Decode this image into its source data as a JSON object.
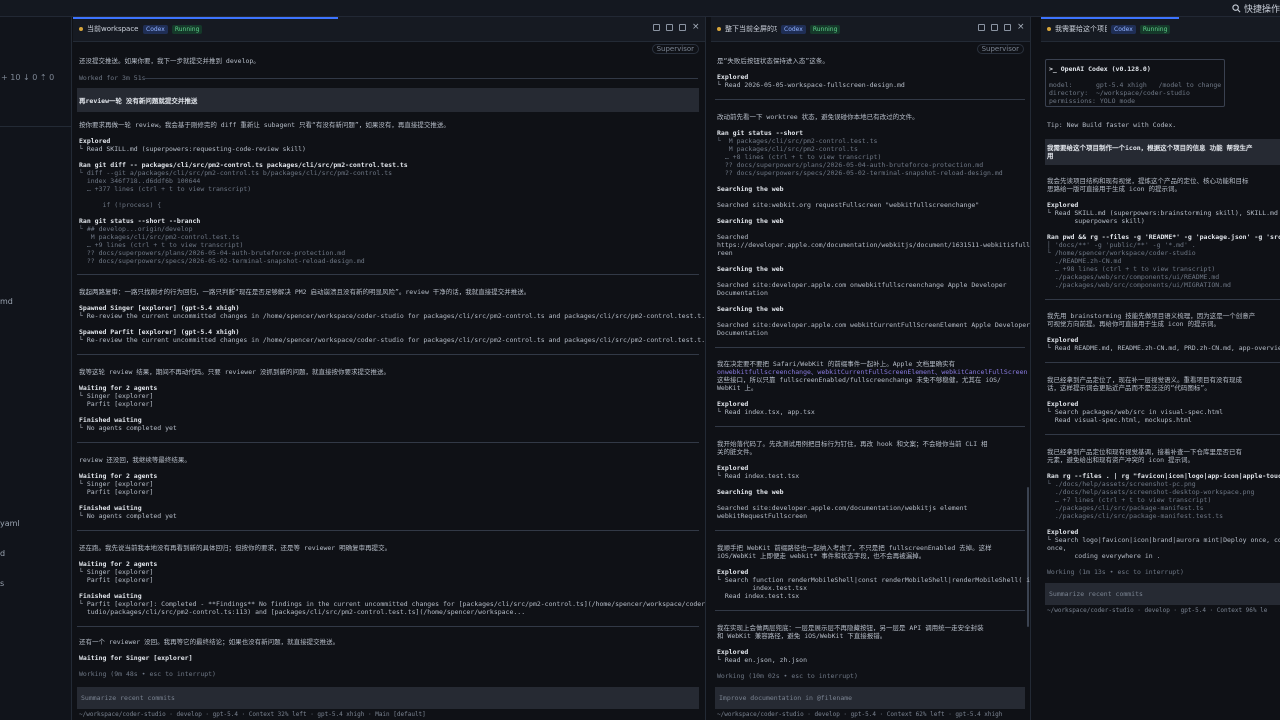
{
  "topbar": {
    "quick_label": "快捷操作"
  },
  "sidebar": {
    "stats": "+ 10  ↓ 0  ⇡ 0",
    "frag_md": "md",
    "frag_yaml": "yaml",
    "frag_d": "d",
    "frag_s": "s"
  },
  "pane_a": {
    "title": "当前workspace...",
    "codex": "Codex",
    "status": "Running",
    "supervisor": "Supervisor",
    "lines": [
      "还没提交推送。如果你要，我下一步就提交并推到 develop。",
      "Worked for 3m 51s",
      "再review一轮 没有新问题就提交并推送",
      "按你要求再做一轮 review。我会基于刚修完的 diff 重新让 subagent 只看“有没有新问题”，如果没有，再直接提交推送。",
      "Explored",
      "└ Read SKILL.md (superpowers:requesting-code-review skill)",
      "Ran git diff -- packages/cli/src/pm2-control.ts packages/cli/src/pm2-control.test.ts",
      "└ diff --git a/packages/cli/src/pm2-control.ts b/packages/cli/src/pm2-control.ts",
      "  index 346f718..d6ddf6b 100644",
      "  … +377 lines (ctrl + t to view transcript)",
      "",
      "      if (!process) {",
      "",
      "Ran git status --short --branch",
      "└ ## develop...origin/develop",
      "   M packages/cli/src/pm2-control.test.ts",
      "  … +9 lines (ctrl + t to view transcript)",
      "  ?? docs/superpowers/plans/2026-05-04-auth-bruteforce-protection.md",
      "  ?? docs/superpowers/specs/2026-05-02-terminal-snapshot-reload-design.md",
      "我起两路复审：一路只找刚才的行为回归，一路只判断“现在是否足够解决 PM2 启动崩溃且没有新的明显风险”。review 干净的话，我就直接提交并推送。",
      "Spawned Singer [explorer] (gpt-5.4 xhigh)",
      "└ Re-review the current uncommitted changes in /home/spencer/workspace/coder-studio for packages/cli/src/pm2-control.ts and packages/cli/src/pm2-control.test.t...",
      "Spawned Parfit [explorer] (gpt-5.4 xhigh)",
      "└ Re-review the current uncommitted changes in /home/spencer/workspace/coder-studio for packages/cli/src/pm2-control.ts and packages/cli/src/pm2-control.test.t...",
      "我等这轮 review 结果，期间不再动代码。只要 reviewer 没抓到新的问题，就直接按你要求提交推送。",
      "Waiting for 2 agents",
      "└ Singer [explorer]",
      "  Parfit [explorer]",
      "Finished waiting",
      "└ No agents completed yet",
      "review 还没回，我继续等最终结果。",
      "Waiting for 2 agents",
      "└ Singer [explorer]",
      "  Parfit [explorer]",
      "Finished waiting",
      "└ No agents completed yet",
      "还在跑。我先说当前我本地没有再看到新的具体回归；但按你的要求，还是等 reviewer 明确复审再提交。",
      "Waiting for 2 agents",
      "└ Singer [explorer]",
      "  Parfit [explorer]",
      "Finished waiting",
      "└ Parfit [explorer]: Completed - **Findings** No findings in the current uncommitted changes for [packages/cli/src/pm2-control.ts](/home/spencer/workspace/coder-",
      "  tudio/packages/cli/src/pm2-control.ts:113) and [packages/cli/src/pm2-control.test.ts](/home/spencer/workspace...",
      "还有一个 reviewer 没回。我再等它的最终结论；如果也没有新问题，就直接提交推送。",
      "Waiting for Singer [explorer]",
      "Working (9m 48s • esc to interrupt)"
    ],
    "input_placeholder": "Summarize recent commits",
    "statusline": "~/workspace/coder-studio · develop · gpt-5.4 · Context 32% left · gpt-5.4 xhigh · Main [default]"
  },
  "pane_b": {
    "title": "整下当前全屏的功能...",
    "codex": "Codex",
    "status": "Running",
    "supervisor": "Supervisor",
    "lines": [
      "是“失败后按钮状态保持进入态”这条。",
      "Explored",
      "└ Read 2026-05-05-workspace-fullscreen-design.md",
      "改动前先看一下 worktree 状态，避免误碰你本地已有改过的文件。",
      "Ran git status --short",
      "└  M packages/cli/src/pm2-control.test.ts",
      "   M packages/cli/src/pm2-control.ts",
      "  … +8 lines (ctrl + t to view transcript)",
      "  ?? docs/superpowers/plans/2026-05-04-auth-bruteforce-protection.md",
      "  ?? docs/superpowers/specs/2026-05-02-terminal-snapshot-reload-design.md",
      "Searching the web",
      "Searched site:webkit.org requestFullscreen \"webkitfullscreenchange\"",
      "Searching the web",
      "Searched",
      "https://developer.apple.com/documentation/webkitjs/document/1631511-webkitisfullsc",
      "reen",
      "Searching the web",
      "Searched site:developer.apple.com onwebkitfullscreenchange Apple Developer",
      "Documentation",
      "Searching the web",
      "Searched site:developer.apple.com webkitCurrentFullScreenElement Apple Developer",
      "Documentation",
      "我在决定要不要把 Safari/WebKit 的前缀事件一起补上。Apple 文档里确实有",
      "onwebkitfullscreenchange、webkitCurrentFullScreenElement、webkitCancelFullScreen",
      "这些接口，所以只靠 fullscreenEnabled/fullscreenchange 未免不够稳健，尤其在 iOS/",
      "WebKit 上。",
      "Explored",
      "└ Read index.tsx, app.tsx",
      "我开始落代码了。先改测试用例把目标行为钉住，再改 hook 和文案；不会碰你当前 CLI 相",
      "关的脏文件。",
      "Explored",
      "└ Read index.test.tsx",
      "Searching the web",
      "Searched site:developer.apple.com/documentation/webkitjs element",
      "webkitRequestFullscreen",
      "我顺手把 WebKit 前缀路径也一起纳入考虑了，不只是把 fullscreenEnabled 去掉。这样",
      "iOS/WebKit 上即便走 webkit* 事件和状态字段，也不会再被漏掉。",
      "Explored",
      "└ Search function renderMobileShell|const renderMobileShell|renderMobileShell( in",
      "         index.test.tsx",
      "  Read index.test.tsx",
      "我在实现上会做两层兜底：一层是展示层不再隐藏按钮，另一层是 API 调用统一走安全封装",
      "和 WebKit 兼容路径，避免 iOS/WebKit 下直接报错。",
      "Explored",
      "└ Read en.json, zh.json",
      "Working (10m 02s • esc to interrupt)"
    ],
    "input_placeholder": "Improve documentation in @filename",
    "statusline": "~/workspace/coder-studio · develop · gpt-5.4 · Context 62% left · gpt-5.4 xhigh"
  },
  "pane_c": {
    "title": "我需要给这个项目制...",
    "codex": "Codex",
    "status": "Running",
    "banner": [
      ">_ OpenAI Codex (v0.128.0)",
      "model:      gpt-5.4 xhigh   /model to change",
      "directory:  ~/workspace/coder-studio",
      "permissions: YOLO mode"
    ],
    "lines": [
      "Tip: New Build faster with Codex.",
      "我需要给这个项目制作一个icon，根据这个项目的信息 功能 帮我生产",
      "用",
      "我会先读项目结构和现有视觉，提炼这个产品的定位、核心功能和目标",
      "思路给一版可直接用于生成 icon 的提示词。",
      "Explored",
      "└ Read SKILL.md (superpowers:brainstorming skill), SKILL.md (",
      "       superpowers skill)",
      "Ran pwd && rg --files -g 'README*' -g 'package.json' -g 'src/",
      "│ 'docs/**' -g 'public/**' -g '*.md' .",
      "└ /home/spencer/workspace/coder-studio",
      "  ./README.zh-CN.md",
      "  … +98 lines (ctrl + t to view transcript)",
      "  ./packages/web/src/components/ui/README.md",
      "  ./packages/web/src/components/ui/MIGRATION.md",
      "我先用 brainstorming 技能先做项目语义梳理，因为这是一个创意产",
      "可视觉方向前提。再给你可直接用于生成 icon 的提示词。",
      "Explored",
      "└ Read README.md, README.zh-CN.md, PRD.zh-CN.md, app-overview",
      "我已经拿到产品定位了，现在补一层视觉语义。重看项目有没有现成",
      "话，这样提示词会更贴近产品而不是泛泛的“代码图标”。",
      "Explored",
      "└ Search packages/web/src in visual-spec.html",
      "  Read visual-spec.html, mockups.html",
      "我已经拿到产品定位和现有视觉基调，接着补查一下仓库里是否已有",
      "元素，避免给出和现有资产冲突的 icon 提示词。",
      "Ran rg --files . | rg \"favicon|icon|logo|app-icon|apple-touch",
      "└ ./docs/help/assets/screenshot-pc.png",
      "  ./docs/help/assets/screenshot-desktop-workspace.png",
      "  … +7 lines (ctrl + t to view transcript)",
      "  ./packages/cli/src/package-manifest.ts",
      "  ./packages/cli/src/package-manifest.test.ts",
      "Explored",
      "└ Search logo|favicon|icon|brand|aurora mint|Deploy once, cod",
      "once,",
      "       coding everywhere in .",
      "Working (1m 13s • esc to interrupt)"
    ],
    "input_placeholder": "Summarize recent commits",
    "statusline": "~/workspace/coder-studio · develop · gpt-5.4 · Context 96% le"
  },
  "colors": {
    "accent": "#3d74ff",
    "running": "#5fd28b",
    "codex": "#8fb0ff"
  }
}
